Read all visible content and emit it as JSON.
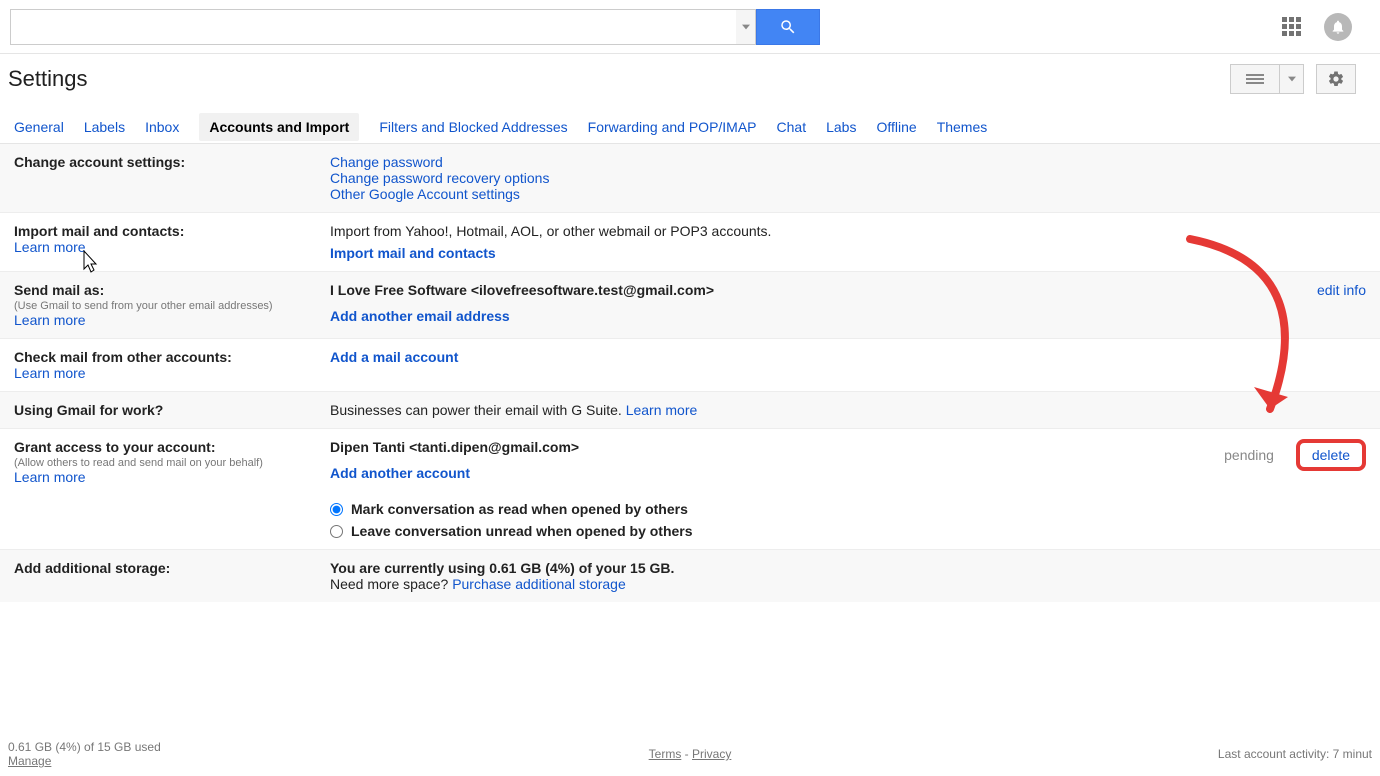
{
  "search": {
    "placeholder": ""
  },
  "page_title": "Settings",
  "tabs": [
    "General",
    "Labels",
    "Inbox",
    "Accounts and Import",
    "Filters and Blocked Addresses",
    "Forwarding and POP/IMAP",
    "Chat",
    "Labs",
    "Offline",
    "Themes"
  ],
  "active_tab": "Accounts and Import",
  "sections": {
    "change_account": {
      "title": "Change account settings:",
      "links": [
        "Change password",
        "Change password recovery options",
        "Other Google Account settings"
      ]
    },
    "import_mail": {
      "title": "Import mail and contacts:",
      "learn": "Learn more",
      "desc": "Import from Yahoo!, Hotmail, AOL, or other webmail or POP3 accounts.",
      "action": "Import mail and contacts"
    },
    "send_as": {
      "title": "Send mail as:",
      "sub": "(Use Gmail to send from your other email addresses)",
      "learn": "Learn more",
      "entry": "I Love Free Software <ilovefreesoftware.test@gmail.com>",
      "edit": "edit info",
      "action": "Add another email address"
    },
    "check_mail": {
      "title": "Check mail from other accounts:",
      "learn": "Learn more",
      "action": "Add a mail account"
    },
    "gsuite": {
      "title": "Using Gmail for work?",
      "desc": "Businesses can power their email with G Suite.",
      "learn": "Learn more"
    },
    "grant": {
      "title": "Grant access to your account:",
      "sub": "(Allow others to read and send mail on your behalf)",
      "learn": "Learn more",
      "entry": "Dipen Tanti <tanti.dipen@gmail.com>",
      "status": "pending",
      "delete": "delete",
      "action": "Add another account",
      "radio1": "Mark conversation as read when opened by others",
      "radio2": "Leave conversation unread when opened by others"
    },
    "storage": {
      "title": "Add additional storage:",
      "line1": "You are currently using 0.61 GB (4%) of your 15 GB.",
      "line2a": "Need more space? ",
      "line2b": "Purchase additional storage"
    }
  },
  "footer": {
    "usage": "0.61 GB (4%) of 15 GB used",
    "manage": "Manage",
    "terms": "Terms",
    "privacy": "Privacy",
    "activity": "Last account activity: 7 minut"
  }
}
